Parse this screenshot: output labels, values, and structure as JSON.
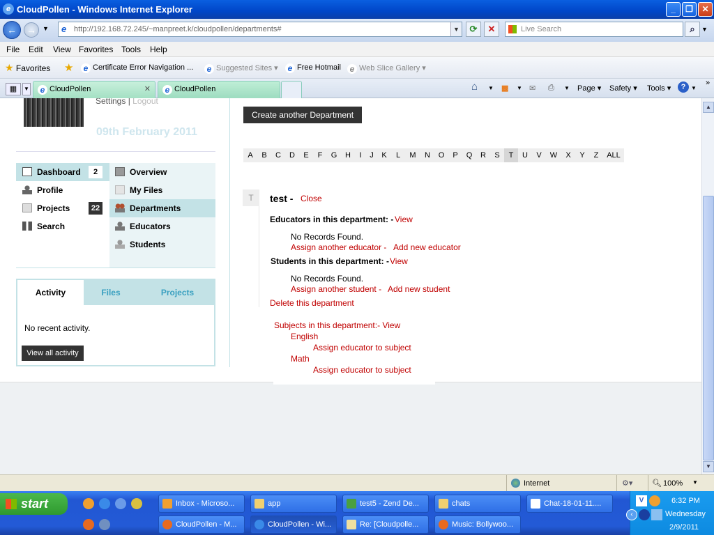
{
  "window": {
    "title": "CloudPollen - Windows Internet Explorer"
  },
  "address": {
    "url": "http://192.168.72.245/~manpreet.k/cloudpollen/departments#",
    "search_placeholder": "Live Search"
  },
  "menu": [
    "File",
    "Edit",
    "View",
    "Favorites",
    "Tools",
    "Help"
  ],
  "favorites_bar": {
    "favorites_label": "Favorites",
    "items": [
      "Certificate Error Navigation ...",
      "Suggested Sites ▾",
      "Free Hotmail",
      "Web Slice Gallery ▾"
    ]
  },
  "tabs": [
    "CloudPollen",
    "CloudPollen"
  ],
  "commandbar": {
    "page": "Page ▾",
    "safety": "Safety ▾",
    "tools": "Tools ▾"
  },
  "page": {
    "settings_link": "Settings",
    "logout_link": "Logout",
    "date": "09th February 2011",
    "left_menu": [
      {
        "label": "Dashboard",
        "icon": "dashboard-icon",
        "badge": "2"
      },
      {
        "label": "Profile",
        "icon": "profile-icon"
      },
      {
        "label": "Projects",
        "icon": "projects-icon",
        "badge": "22"
      },
      {
        "label": "Search",
        "icon": "binoculars-icon"
      }
    ],
    "right_menu": [
      {
        "label": "Overview",
        "icon": "overview-icon"
      },
      {
        "label": "My Files",
        "icon": "files-icon"
      },
      {
        "label": "Departments",
        "icon": "departments-icon"
      },
      {
        "label": "Educators",
        "icon": "educator-icon"
      },
      {
        "label": "Students",
        "icon": "student-icon"
      }
    ],
    "activity_tabs": [
      "Activity",
      "Files",
      "Projects"
    ],
    "no_activity": "No recent activity.",
    "view_all": "View all activity",
    "create_button": "Create another Department",
    "alphabet": [
      "A",
      "B",
      "C",
      "D",
      "E",
      "F",
      "G",
      "H",
      "I",
      "J",
      "K",
      "L",
      "M",
      "N",
      "O",
      "P",
      "Q",
      "R",
      "S",
      "T",
      "U",
      "V",
      "W",
      "X",
      "Y",
      "Z",
      "ALL"
    ],
    "selected_letter": "T",
    "department": {
      "letter": "T",
      "name": "test -",
      "close": "Close",
      "educators_heading": "Educators in this department: -",
      "educators_view": "View",
      "educators_none": "No Records Found.",
      "assign_educator": "Assign another educator -",
      "add_educator": "Add new educator",
      "students_heading": "Students in this department: -",
      "students_view": "View",
      "students_none": "No Records Found.",
      "assign_student": "Assign another student -",
      "add_student": "Add new student",
      "delete": "Delete this department",
      "subjects_heading": "Subjects in this department:- View",
      "subjects": [
        {
          "name": "English",
          "action": "Assign educator to subject"
        },
        {
          "name": "Math",
          "action": "Assign educator to subject"
        }
      ]
    }
  },
  "status": {
    "zone": "Internet",
    "zoom": "100%"
  },
  "taskbar": {
    "start": "start",
    "row1": [
      "Inbox - Microso...",
      "app",
      "test5 - Zend De...",
      "chats",
      "Chat-18-01-11...."
    ],
    "row2": [
      "CloudPollen - M...",
      "CloudPollen - Wi...",
      "Re: [Cloudpolle...",
      "Music: Bollywoo..."
    ],
    "clock": {
      "time": "6:32 PM",
      "day": "Wednesday",
      "date": "2/9/2011"
    }
  },
  "colors": {
    "link_red": "#c00000",
    "menu_highlight": "#c3e2e6",
    "taskbar_blue": "#245edb"
  }
}
